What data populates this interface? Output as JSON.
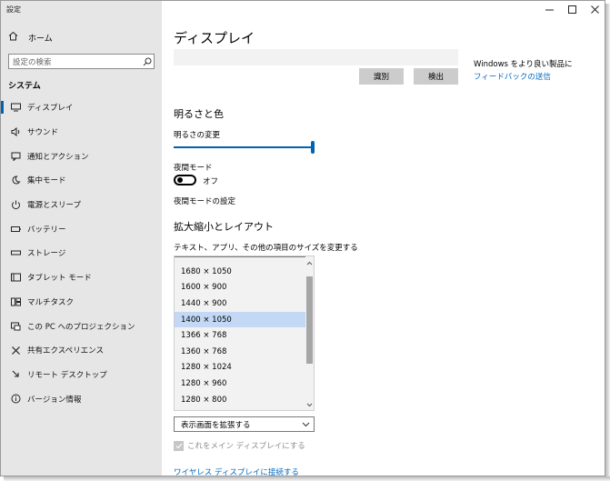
{
  "window": {
    "title": "設定"
  },
  "sidebar": {
    "home_label": "ホーム",
    "search_placeholder": "設定の検索",
    "section_title": "システム",
    "items": [
      {
        "label": "ディスプレイ",
        "icon": "display-icon",
        "active": true
      },
      {
        "label": "サウンド",
        "icon": "speaker-icon"
      },
      {
        "label": "通知とアクション",
        "icon": "notification-icon"
      },
      {
        "label": "集中モード",
        "icon": "moon-icon"
      },
      {
        "label": "電源とスリープ",
        "icon": "power-icon"
      },
      {
        "label": "バッテリー",
        "icon": "battery-icon"
      },
      {
        "label": "ストレージ",
        "icon": "storage-icon"
      },
      {
        "label": "タブレット モード",
        "icon": "tablet-icon"
      },
      {
        "label": "マルチタスク",
        "icon": "multitask-icon"
      },
      {
        "label": "この PC へのプロジェクション",
        "icon": "projection-icon"
      },
      {
        "label": "共有エクスペリエンス",
        "icon": "shared-icon"
      },
      {
        "label": "リモート デスクトップ",
        "icon": "remote-icon"
      },
      {
        "label": "バージョン情報",
        "icon": "info-icon"
      }
    ]
  },
  "main": {
    "title": "ディスプレイ",
    "identify_button": "識別",
    "detect_button": "検出",
    "feedback_text": "Windows をより良い製品に",
    "feedback_link": "フィードバックの送信",
    "brightness_section": "明るさと色",
    "brightness_label": "明るさの変更",
    "brightness_value": 1.0,
    "night_mode_label": "夜間モード",
    "night_mode_state": "オフ",
    "night_mode_link": "夜間モードの設定",
    "scale_section": "拡大縮小とレイアウト",
    "scale_label": "テキスト、アプリ、その他の項目のサイズを変更する",
    "resolutions": [
      "1680 × 1050",
      "1600 × 900",
      "1440 × 900",
      "1400 × 1050",
      "1366 × 768",
      "1360 × 768",
      "1280 × 1024",
      "1280 × 960",
      "1280 × 800"
    ],
    "selected_resolution": "1400 × 1050",
    "multi_display_value": "表示画面を拡張する",
    "main_display_checkbox": "これをメイン ディスプレイにする",
    "wireless_link": "ワイヤレス ディスプレイに接続する"
  },
  "colors": {
    "accent": "#0063b1",
    "link": "#0067c0",
    "sidebar_bg": "#e6e6e6",
    "selection": "#c2d8f5"
  }
}
